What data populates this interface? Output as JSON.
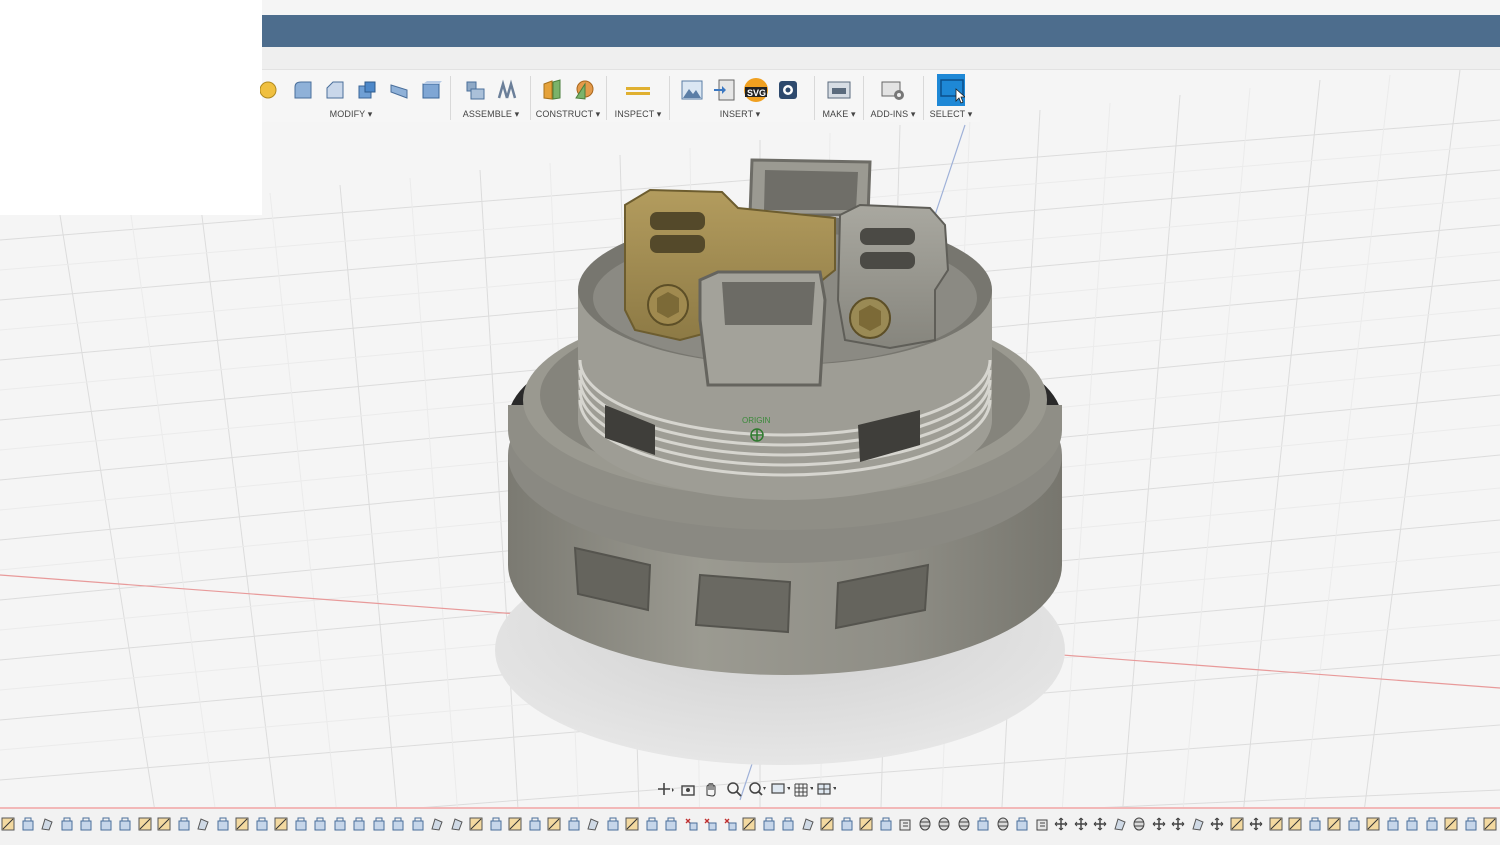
{
  "app": {
    "accent": "#4d6d8d",
    "select_color": "#1e88d6"
  },
  "toolbar": {
    "groups": [
      {
        "id": "modify",
        "label": "MODIFY ▾",
        "icons": [
          "press-pull-icon",
          "fillet-icon",
          "chamfer-icon",
          "shell-icon",
          "draft-icon",
          "scale-icon"
        ]
      },
      {
        "id": "assemble",
        "label": "ASSEMBLE ▾",
        "icons": [
          "new-component-icon",
          "joint-icon"
        ]
      },
      {
        "id": "construct",
        "label": "CONSTRUCT ▾",
        "icons": [
          "offset-plane-icon",
          "plane-at-angle-icon"
        ]
      },
      {
        "id": "inspect",
        "label": "INSPECT ▾",
        "icons": [
          "measure-icon"
        ]
      },
      {
        "id": "insert",
        "label": "INSERT ▾",
        "icons": [
          "canvas-icon",
          "insert-dxf-icon",
          "insert-svg-icon",
          "insert-mcmaster-icon"
        ]
      },
      {
        "id": "make",
        "label": "MAKE ▾",
        "icons": [
          "3d-print-icon"
        ]
      },
      {
        "id": "addins",
        "label": "ADD-INS ▾",
        "icons": [
          "scripts-addins-icon"
        ]
      },
      {
        "id": "select",
        "label": "SELECT ▾",
        "icons": [
          "select-icon"
        ]
      }
    ]
  },
  "viewport": {
    "origin_label": "ORIGIN"
  },
  "navbar": {
    "items": [
      "orbit-icon",
      "look-at-icon",
      "pan-icon",
      "zoom-icon",
      "fit-icon",
      "display-settings-icon",
      "grid-settings-icon",
      "viewports-icon"
    ]
  },
  "timeline": {
    "feature_count": 79
  }
}
